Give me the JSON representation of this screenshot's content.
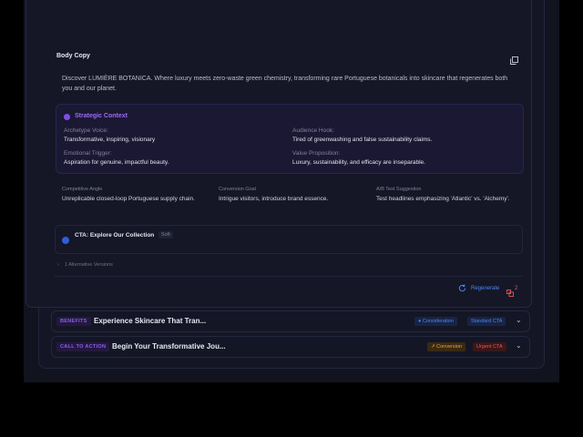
{
  "body_copy": {
    "title": "Body Copy",
    "text": "Discover LUMIÈRE BOTANICA. Where luxury meets zero-waste green chemistry, transforming rare Portuguese botanicals into skincare that regenerates both you and our planet."
  },
  "strategic_context": {
    "title": "Strategic Context",
    "archetype_label": "Archetype Voice:",
    "archetype_value": "Transformative, inspiring, visionary",
    "audience_label": "Audience Hook:",
    "audience_value": "Tired of greenwashing and false sustainability claims.",
    "emotional_label": "Emotional Trigger:",
    "emotional_value": "Aspiration for genuine, impactful beauty.",
    "value_label": "Value Proposition:",
    "value_value": "Luxury, sustainability, and efficacy are inseparable."
  },
  "details": {
    "competitive_label": "Competitive Angle",
    "competitive_value": "Unreplicable closed-loop Portuguese supply chain.",
    "conversion_label": "Conversion Goal",
    "conversion_value": "Intrigue visitors, introduce brand essence.",
    "ab_label": "A/B Test Suggestion",
    "ab_value": "Test headlines emphasizing 'Atlantic' vs. 'Alchemy'."
  },
  "cta": {
    "text": "CTA: Explore Our Collection",
    "badge": "Soft"
  },
  "alternatives": {
    "label": "1 Alternative Versions",
    "chevron": "›"
  },
  "actions": {
    "regenerate": "Regenerate",
    "flag_count": "2"
  },
  "sections": [
    {
      "tag": "BENEFITS",
      "title": "Experience Skincare That Tran...",
      "stage": "Consideration",
      "cta_type": "Standard CTA"
    },
    {
      "tag": "CALL TO ACTION",
      "title": "Begin Your Transformative Jou...",
      "stage": "Conversion",
      "cta_type": "Urgent CTA"
    }
  ],
  "colors": {
    "accent_purple": "#8a5ee8",
    "accent_blue": "#4d86f0",
    "accent_orange": "#e9a23b",
    "accent_red": "#e25858"
  }
}
